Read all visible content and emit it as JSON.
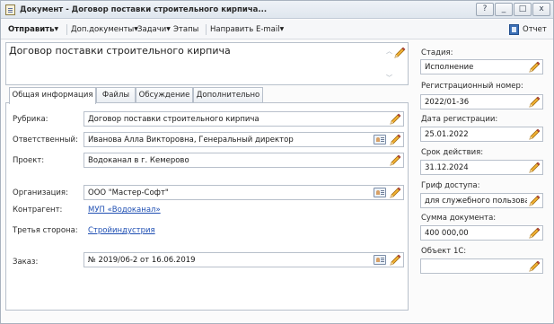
{
  "window": {
    "title": "Документ - Договор поставки строительного кирпича...",
    "controls": [
      "?",
      "_",
      "□",
      "x"
    ]
  },
  "toolbar": {
    "send": "Отправить",
    "docs": "Доп.документы",
    "tasks": "Задачи",
    "stages": "Этапы",
    "email": "Направить E-mail",
    "report": "Отчет"
  },
  "document": {
    "title": "Договор поставки строительного кирпича"
  },
  "tabs": [
    "Общая информация",
    "Файлы",
    "Обсуждение",
    "Дополнительно"
  ],
  "general": {
    "rubric_label": "Рубрика:",
    "rubric_value": "Договор поставки строительного кирпича",
    "responsible_label": "Ответственный:",
    "responsible_value": "Иванова Алла Викторовна, Генеральный директор",
    "project_label": "Проект:",
    "project_value": "Водоканал в г. Кемерово",
    "organization_label": "Организация:",
    "organization_value": "ООО \"Мастер-Софт\"",
    "counterparty_label": "Контрагент:",
    "counterparty_value": "МУП «Водоканал»",
    "third_party_label": "Третья сторона:",
    "third_party_value": "Стройиндустрия",
    "order_label": "Заказ:",
    "order_value": "№ 2019/06-2 от 16.06.2019"
  },
  "side": {
    "stage_label": "Стадия:",
    "stage_value": "Исполнение",
    "regnum_label": "Регистрационный номер:",
    "regnum_value": "2022/01-36",
    "regdate_label": "Дата регистрации:",
    "regdate_value": "25.01.2022",
    "term_label": "Срок действия:",
    "term_value": "31.12.2024",
    "access_label": "Гриф доступа:",
    "access_value": "для служебного пользовани",
    "sum_label": "Сумма документа:",
    "sum_value": "400 000,00",
    "obj1c_label": "Объект 1С:",
    "obj1c_value": ""
  }
}
